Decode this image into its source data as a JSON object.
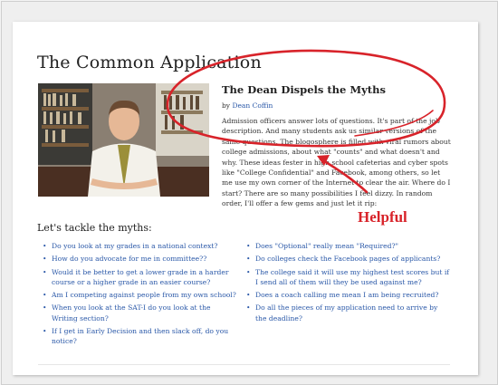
{
  "page": {
    "title": "The Common Application"
  },
  "article": {
    "title": "The Dean Dispels the Myths",
    "byline_prefix": "by",
    "author": "Dean Coffin",
    "body": "Admission officers answer lots of questions.  It's part of the job description.  And many students ask us similar versions of the same questions. The blogosphere is filled with viral rumors about college admissions, about what \"counts\" and what doesn't and why. These ideas fester in high school cafeterias and cyber spots like \"College Confidential\" and Facebook, among others, so let me use my own corner of the Internet to clear the air. Where do I start? There are so many possibilities I feel dizzy. In random order, I'll offer a few gems and just let it rip:"
  },
  "myths": {
    "heading": "Let's tackle the myths:",
    "left": [
      "Do you look at my grades in a national context?",
      "How do you advocate for me in committee??",
      "Would it be better to get a lower grade in a harder course or a higher grade in an easier course?",
      "Am I competing against people from my own school?",
      "When you look at the SAT-I do you look at the Writing section?",
      "If I get in Early Decision and then slack off, do you notice?"
    ],
    "right": [
      "Does \"Optional\" really mean \"Required?\"",
      "Do colleges check the Facebook pages of applicants?",
      "The college said it will use my highest test scores but if I send all of them will they be used against me?",
      "Does a coach calling me mean I am being recruited?",
      "Do all the pieces of my application need to arrive by the deadline?"
    ]
  },
  "annotation": {
    "label": "Helpful",
    "color": "#d8232a"
  },
  "colors": {
    "link": "#2a58a8",
    "annotation": "#d8232a"
  }
}
